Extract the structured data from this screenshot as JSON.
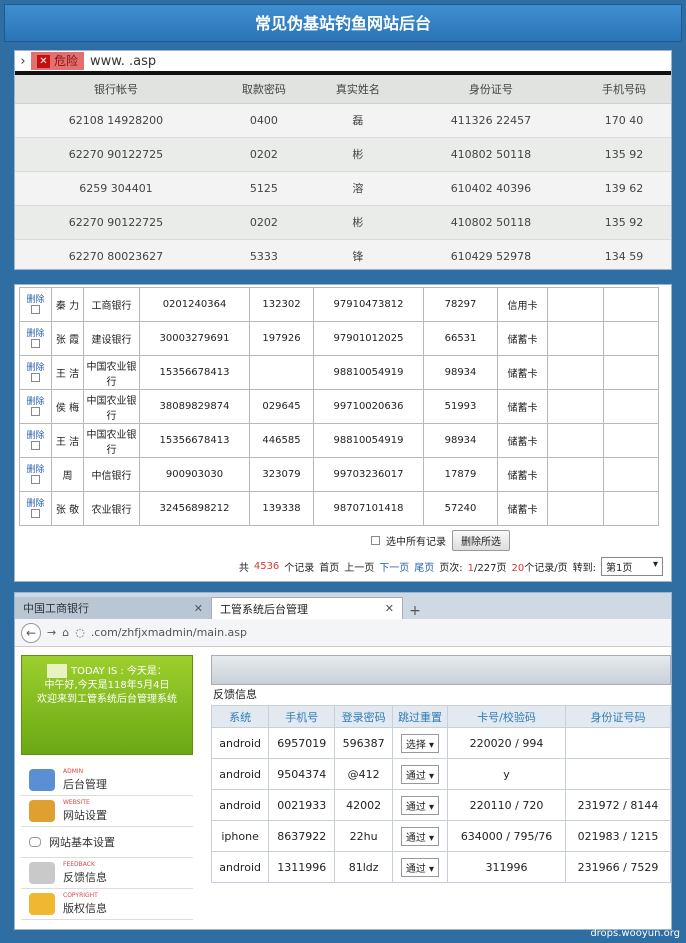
{
  "title": "常见伪基站钓鱼网站后台",
  "panel1": {
    "danger_label": "危险",
    "url": "www.               .asp",
    "columns": [
      "银行帐号",
      "取款密码",
      "真实姓名",
      "身份证号",
      "手机号码"
    ],
    "rows": [
      [
        "62108      14928200",
        "0400",
        "磊",
        "411326          22457",
        "170      40"
      ],
      [
        "62270      90122725",
        "0202",
        "彬",
        "410802          50118",
        "135      92"
      ],
      [
        "6259      304401",
        "5125",
        "溶",
        "610402          40396",
        "139      62"
      ],
      [
        "62270      90122725",
        "0202",
        "彬",
        "410802          50118",
        "135      92"
      ],
      [
        "62270      80023627",
        "5333",
        "锋",
        "610429          52978",
        "134      59"
      ]
    ]
  },
  "panel2": {
    "delete_label": "删除",
    "rows": [
      {
        "name": "秦  力",
        "bank": "工商银行",
        "card": "0201240364",
        "pin": "132302",
        "id": "97910473812",
        "phone": "78297",
        "type": "信用卡"
      },
      {
        "name": "张  霞",
        "bank": "建设银行",
        "card": "30003279691",
        "pin": "197926",
        "id": "97901012025",
        "phone": "66531",
        "type": "储蓄卡"
      },
      {
        "name": "王  洁",
        "bank": "中国农业银行",
        "card": "15356678413",
        "pin": "",
        "id": "98810054919",
        "phone": "98934",
        "type": "储蓄卡"
      },
      {
        "name": "侯  梅",
        "bank": "中国农业银行",
        "card": "38089829874",
        "pin": "029645",
        "id": "99710020636",
        "phone": "51993",
        "type": "储蓄卡"
      },
      {
        "name": "王  洁",
        "bank": "中国农业银行",
        "card": "15356678413",
        "pin": "446585",
        "id": "98810054919",
        "phone": "98934",
        "type": "储蓄卡"
      },
      {
        "name": "周  ",
        "bank": "中信银行",
        "card": "900903030",
        "pin": "323079",
        "id": "99703236017",
        "phone": "17879",
        "type": "储蓄卡"
      },
      {
        "name": "张  敬",
        "bank": "农业银行",
        "card": "32456898212",
        "pin": "139338",
        "id": "98707101418",
        "phone": "57240",
        "type": "储蓄卡"
      }
    ],
    "select_all": "选中所有记录",
    "delete_selected": "删除所选",
    "pager": {
      "total_prefix": "共",
      "total": "4536",
      "total_suffix": "个记录",
      "first": "首页",
      "prev": "上一页",
      "next": "下一页",
      "last": "尾页",
      "page_label": "页次:",
      "page_current": "1",
      "page_total": "/227页",
      "per_page": "20",
      "per_page_suffix": "个记录/页",
      "goto": "转到:",
      "goto_value": "第1页"
    }
  },
  "panel3": {
    "tab1": "中国工商银行",
    "tab2": "工管系统后台管理",
    "url": ".com/zhfjxmadmin/main.asp",
    "greeting_today": "TODAY IS : 今天是：",
    "greeting_line2": "中午好,今天是118年5月4日",
    "greeting_line3": "欢迎来到工管系统后台管理系统",
    "menu": [
      {
        "en": "ADMIN",
        "label": "后台管理",
        "color": "#5a8fd4"
      },
      {
        "en": "WEBSITE",
        "label": "网站设置",
        "color": "#e0a030"
      },
      {
        "en": "",
        "label": "网站基本设置",
        "color": ""
      },
      {
        "en": "FEEDBACK",
        "label": "反馈信息",
        "color": "#c9c9c9"
      },
      {
        "en": "COPYRIGHT",
        "label": "版权信息",
        "color": "#f0b830"
      }
    ],
    "feedback_title": "反馈信息",
    "columns": [
      "系统",
      "手机号",
      "登录密码",
      "跳过重置",
      "卡号/校验码",
      "身份证号码"
    ],
    "rows": [
      {
        "sys": "android",
        "phone": "6957019",
        "pwd": "596387",
        "skip": "选择",
        "card": "220020 / 994",
        "id": ""
      },
      {
        "sys": "android",
        "phone": "9504374",
        "pwd": "@412",
        "skip": "通过",
        "card": "y",
        "id": ""
      },
      {
        "sys": "android",
        "phone": "0021933",
        "pwd": "42002",
        "skip": "通过",
        "card": "220110 / 720",
        "id": "231972 / 8144"
      },
      {
        "sys": "iphone",
        "phone": "8637922",
        "pwd": "22hu",
        "skip": "通过",
        "card": "634000 / 795/76",
        "id": "021983 / 1215"
      },
      {
        "sys": "android",
        "phone": "1311996",
        "pwd": "81ldz",
        "skip": "通过",
        "card": "311996",
        "id": "231966 / 7529"
      }
    ]
  },
  "watermark": "drops.wooyun.org"
}
